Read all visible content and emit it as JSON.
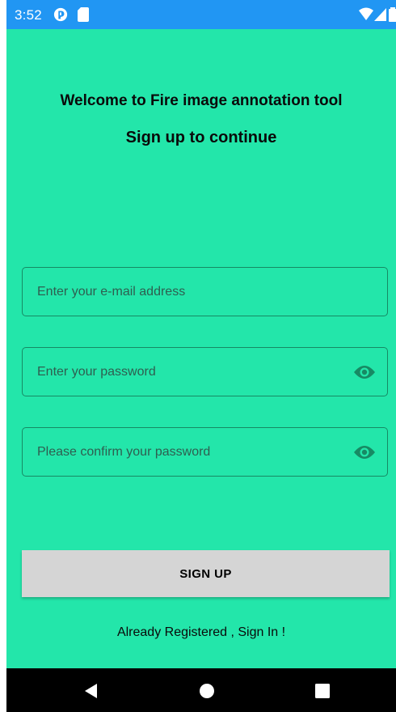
{
  "status_bar": {
    "time": "3:52",
    "icons": [
      "app-notification-icon",
      "sd-card-icon",
      "wifi-icon",
      "signal-icon",
      "battery-icon"
    ],
    "color": "#2196f3"
  },
  "header": {
    "welcome": "Welcome to Fire image annotation tool",
    "subtitle": "Sign up to continue"
  },
  "form": {
    "email_placeholder": "Enter your e-mail address",
    "email_value": "",
    "password_placeholder": "Enter your password",
    "password_value": "",
    "confirm_placeholder": "Please confirm your password",
    "confirm_value": "",
    "visibility_icon": "eye-icon"
  },
  "actions": {
    "signup_label": "SIGN UP",
    "signin_link": "Already Registered , Sign In !"
  },
  "navigation": {
    "buttons": [
      "back-icon",
      "home-icon",
      "recents-icon"
    ]
  },
  "colors": {
    "background": "#23e6aa",
    "accent": "#178a64",
    "button": "#d5d5d5"
  }
}
